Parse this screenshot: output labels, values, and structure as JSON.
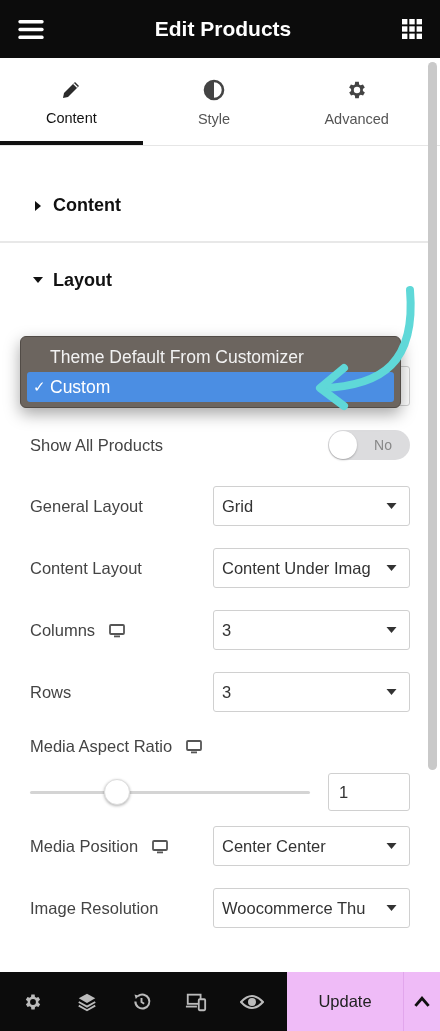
{
  "header": {
    "title": "Edit Products"
  },
  "tabs": [
    {
      "label": "Content",
      "selected": true
    },
    {
      "label": "Style",
      "selected": false
    },
    {
      "label": "Advanced",
      "selected": false
    }
  ],
  "sections": [
    {
      "title": "Content",
      "expanded": false
    },
    {
      "title": "Layout",
      "expanded": true
    }
  ],
  "dropdown_menu": {
    "check": "✓",
    "options": [
      {
        "label": "Theme Default From Customizer",
        "selected": false
      },
      {
        "label": "Custom",
        "selected": true
      }
    ]
  },
  "controls": [
    {
      "kind": "toggle",
      "label": "Show All Products",
      "on": false,
      "value": "No"
    },
    {
      "kind": "select",
      "label": "General Layout",
      "value": "Grid",
      "responsive": false
    },
    {
      "kind": "select",
      "label": "Content Layout",
      "value": "Content Under Imag",
      "responsive": false
    },
    {
      "kind": "select",
      "label": "Columns",
      "value": "3",
      "responsive": true
    },
    {
      "kind": "select",
      "label": "Rows",
      "value": "3",
      "responsive": false
    },
    {
      "kind": "heading",
      "label": "Media Aspect Ratio",
      "responsive": true
    },
    {
      "kind": "slider",
      "level": 0.31,
      "value": "1"
    },
    {
      "kind": "select",
      "label": "Media Position",
      "value": "Center Center",
      "responsive": true
    },
    {
      "kind": "select",
      "label": "Image Resolution",
      "value": "Woocommerce Thu",
      "responsive": false
    }
  ],
  "footer": {
    "update_label": "Update"
  }
}
